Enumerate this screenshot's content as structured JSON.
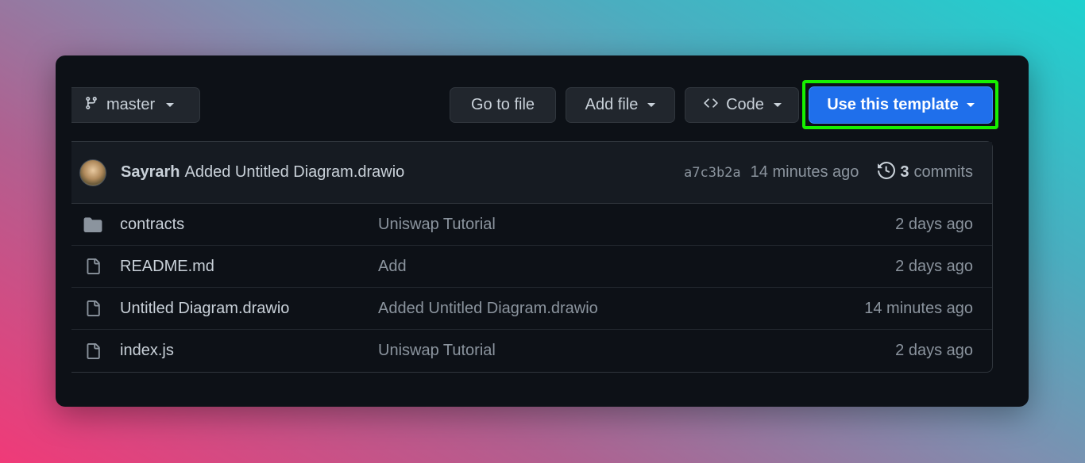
{
  "toolbar": {
    "branch_label": "master",
    "goto_label": "Go to file",
    "add_label": "Add file",
    "code_label": "Code",
    "template_label": "Use this template"
  },
  "commit": {
    "author": "Sayrarh",
    "message": "Added Untitled Diagram.drawio",
    "sha": "a7c3b2a",
    "time": "14 minutes ago",
    "commit_count": "3",
    "commits_label": "commits"
  },
  "files": [
    {
      "type": "folder",
      "name": "contracts",
      "message": "Uniswap Tutorial",
      "age": "2 days ago"
    },
    {
      "type": "file",
      "name": "README.md",
      "message": "Add",
      "age": "2 days ago"
    },
    {
      "type": "file",
      "name": "Untitled Diagram.drawio",
      "message": "Added Untitled Diagram.drawio",
      "age": "14 minutes ago"
    },
    {
      "type": "file",
      "name": "index.js",
      "message": "Uniswap Tutorial",
      "age": "2 days ago"
    }
  ],
  "colors": {
    "highlight": "#17f000",
    "primary_button": "#1f6feb",
    "panel_bg": "#0d1117"
  }
}
